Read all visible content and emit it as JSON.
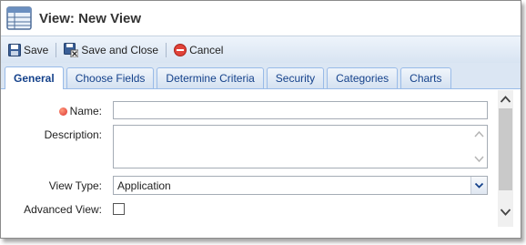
{
  "window": {
    "title": "View: New View",
    "icon": "table-grid-icon"
  },
  "toolbar": {
    "save_label": "Save",
    "save_close_label": "Save and Close",
    "cancel_label": "Cancel"
  },
  "tabs": [
    {
      "label": "General",
      "active": true
    },
    {
      "label": "Choose Fields",
      "active": false
    },
    {
      "label": "Determine Criteria",
      "active": false
    },
    {
      "label": "Security",
      "active": false
    },
    {
      "label": "Categories",
      "active": false
    },
    {
      "label": "Charts",
      "active": false
    }
  ],
  "form": {
    "name_label": "Name:",
    "name_value": "",
    "description_label": "Description:",
    "description_value": "",
    "view_type_label": "View Type:",
    "view_type_value": "Application",
    "advanced_label": "Advanced View:",
    "advanced_checked": false
  },
  "colors": {
    "accent": "#15428b",
    "tab_bg": "#dbe6f3",
    "required": "#dd3333"
  }
}
